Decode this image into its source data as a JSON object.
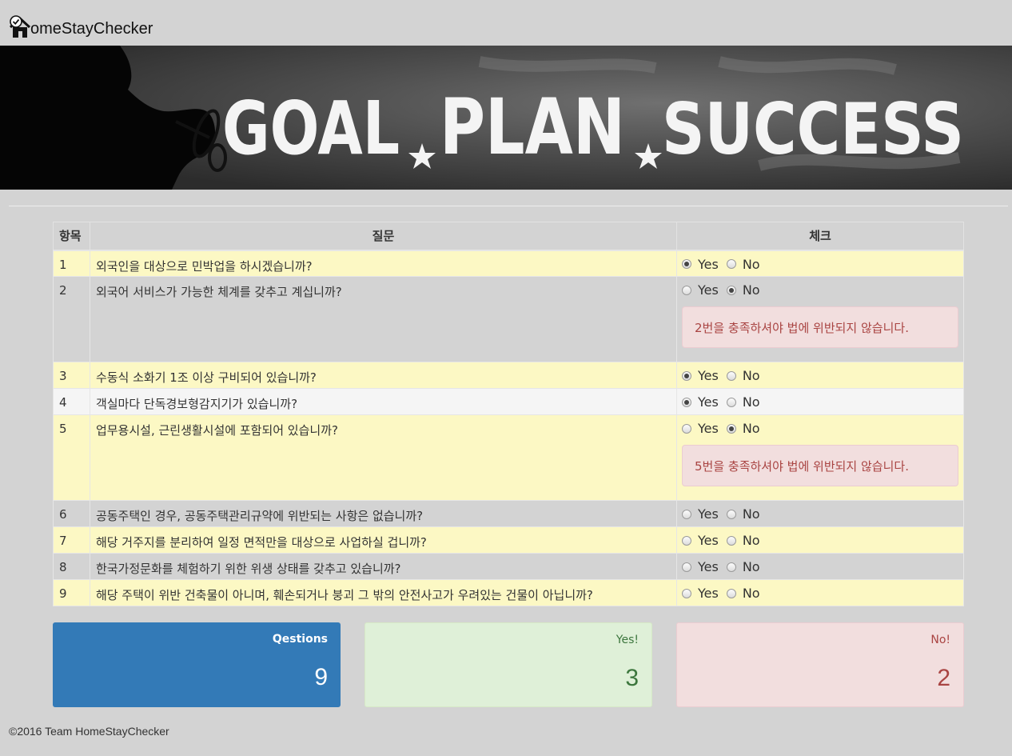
{
  "app": {
    "brand_text": "omeStayChecker",
    "brand_icon": "house-check-icon"
  },
  "banner": {
    "word1": "GOAL",
    "word2": "PLAN",
    "word3": "SUCCESS"
  },
  "table": {
    "headers": {
      "num": "항목",
      "question": "질문",
      "check": "체크"
    },
    "yes_label": "Yes",
    "no_label": "No",
    "rows": [
      {
        "num": "1",
        "question": "외국인을 대상으로 민박업을 하시겠습니까?",
        "answer": "yes",
        "alert": ""
      },
      {
        "num": "2",
        "question": "외국어 서비스가 가능한 체계를 갖추고 계십니까?",
        "answer": "no",
        "alert": "2번을 충족하셔야 법에 위반되지 않습니다."
      },
      {
        "num": "3",
        "question": "수동식 소화기 1조 이상 구비되어 있습니까?",
        "answer": "yes",
        "alert": ""
      },
      {
        "num": "4",
        "question": "객실마다 단독경보형감지기가 있습니까?",
        "answer": "yes",
        "alert": ""
      },
      {
        "num": "5",
        "question": "업무용시설, 근린생활시설에 포함되어 있습니까?",
        "answer": "no",
        "alert": "5번을 충족하셔야 법에 위반되지 않습니다."
      },
      {
        "num": "6",
        "question": "공동주택인 경우, 공동주택관리규약에 위반되는 사항은 없습니까?",
        "answer": "",
        "alert": ""
      },
      {
        "num": "7",
        "question": "해당 거주지를 분리하여 일정 면적만을 대상으로 사업하실 겁니까?",
        "answer": "",
        "alert": ""
      },
      {
        "num": "8",
        "question": "한국가정문화를 체험하기 위한 위생 상태를 갖추고 있습니까?",
        "answer": "",
        "alert": ""
      },
      {
        "num": "9",
        "question": "해당 주택이 위반 건축물이 아니며, 훼손되거나 붕괴 그 밖의 안전사고가 우려있는 건물이 아닙니까?",
        "answer": "",
        "alert": ""
      }
    ]
  },
  "summary": {
    "questions_label": "Qestions",
    "questions_value": "9",
    "yes_label": "Yes!",
    "yes_value": "3",
    "no_label": "No!",
    "no_value": "2"
  },
  "footer": {
    "text": "©2016 Team HomeStayChecker"
  },
  "colors": {
    "page_bg": "#d3d3d3",
    "row_yellow": "#fcf8c4",
    "alert_bg": "#f2dede",
    "alert_text": "#a94442",
    "panel_blue": "#337ab7",
    "panel_green": "#dff0d8",
    "panel_red": "#f2dede"
  }
}
